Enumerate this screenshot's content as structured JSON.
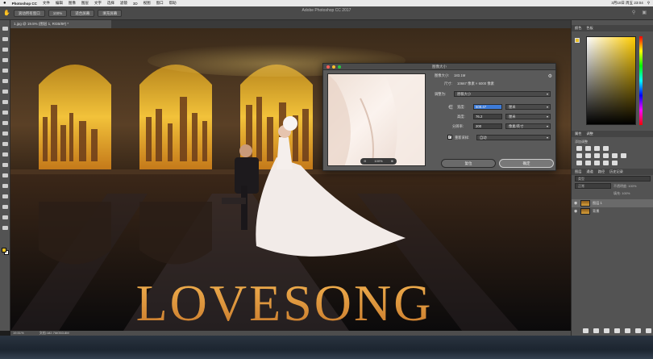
{
  "menubar": {
    "apple": "",
    "app_name": "Photoshop CC",
    "items": [
      "文件",
      "编辑",
      "图像",
      "图层",
      "文字",
      "选择",
      "滤镜",
      "3D",
      "视图",
      "窗口",
      "帮助"
    ],
    "clock": "3月10日 周五 23:04"
  },
  "window": {
    "title": "Adobe Photoshop CC 2017"
  },
  "options_bar": {
    "buttons": [
      "滚动所有窗口",
      "100%",
      "适合屏幕",
      "填充屏幕"
    ]
  },
  "document": {
    "tab_label": "1.jpg @ 19.5% (图层 1, RGB/8#) *"
  },
  "status_bar": {
    "zoom": "19.51%",
    "doc_size": "文档:182.7M/353.8M"
  },
  "canvas": {
    "headline": "LOVESONG"
  },
  "panels": {
    "color_tabs": [
      "颜色",
      "色板"
    ],
    "adjust_tabs": [
      "属性",
      "调整"
    ],
    "adjust_label": "添加调整",
    "layers_tabs": [
      "图层",
      "通道",
      "路径",
      "历史记录"
    ],
    "layers_search": "类型",
    "blend_mode": "正常",
    "opacity_label": "不透明度: 100%",
    "fill_label": "填充: 100%",
    "layers": [
      {
        "name": "图层 1",
        "selected": true
      },
      {
        "name": "背景",
        "selected": false
      }
    ]
  },
  "dialog": {
    "title": "图像大小",
    "image_size_label": "图像大小:",
    "image_size_value": "183.1M",
    "dimensions_label": "尺寸:",
    "dimensions_value": "10667 像素 × 6000 像素",
    "fit_label": "调整为:",
    "fit_value": "原稿大小",
    "width_label": "宽度:",
    "width_value": "508.47",
    "width_unit": "厘米",
    "height_label": "高度:",
    "height_value": "76.2",
    "height_unit": "厘米",
    "resolution_label": "分辨率:",
    "resolution_value": "200",
    "resolution_unit": "像素/英寸",
    "resample_label": "重新采样:",
    "resample_value": "自动",
    "preview_zoom": "100%",
    "cancel": "复位",
    "ok": "确定"
  }
}
